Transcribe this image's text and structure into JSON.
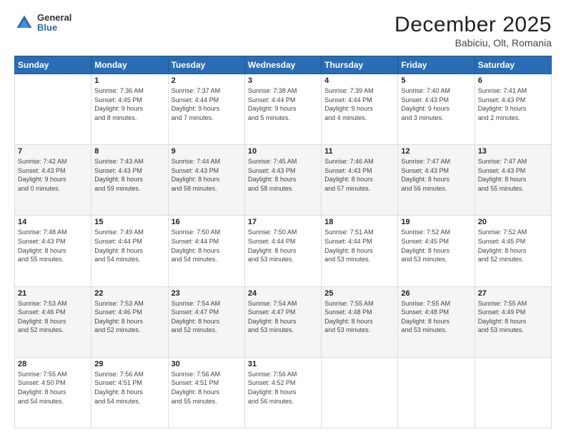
{
  "header": {
    "logo_general": "General",
    "logo_blue": "Blue",
    "title": "December 2025",
    "subtitle": "Babiciu, Olt, Romania"
  },
  "weekdays": [
    "Sunday",
    "Monday",
    "Tuesday",
    "Wednesday",
    "Thursday",
    "Friday",
    "Saturday"
  ],
  "weeks": [
    [
      {
        "day": "",
        "info": ""
      },
      {
        "day": "1",
        "info": "Sunrise: 7:36 AM\nSunset: 4:45 PM\nDaylight: 9 hours\nand 8 minutes."
      },
      {
        "day": "2",
        "info": "Sunrise: 7:37 AM\nSunset: 4:44 PM\nDaylight: 9 hours\nand 7 minutes."
      },
      {
        "day": "3",
        "info": "Sunrise: 7:38 AM\nSunset: 4:44 PM\nDaylight: 9 hours\nand 5 minutes."
      },
      {
        "day": "4",
        "info": "Sunrise: 7:39 AM\nSunset: 4:44 PM\nDaylight: 9 hours\nand 4 minutes."
      },
      {
        "day": "5",
        "info": "Sunrise: 7:40 AM\nSunset: 4:43 PM\nDaylight: 9 hours\nand 3 minutes."
      },
      {
        "day": "6",
        "info": "Sunrise: 7:41 AM\nSunset: 4:43 PM\nDaylight: 9 hours\nand 2 minutes."
      }
    ],
    [
      {
        "day": "7",
        "info": "Sunrise: 7:42 AM\nSunset: 4:43 PM\nDaylight: 9 hours\nand 0 minutes."
      },
      {
        "day": "8",
        "info": "Sunrise: 7:43 AM\nSunset: 4:43 PM\nDaylight: 8 hours\nand 59 minutes."
      },
      {
        "day": "9",
        "info": "Sunrise: 7:44 AM\nSunset: 4:43 PM\nDaylight: 8 hours\nand 58 minutes."
      },
      {
        "day": "10",
        "info": "Sunrise: 7:45 AM\nSunset: 4:43 PM\nDaylight: 8 hours\nand 58 minutes."
      },
      {
        "day": "11",
        "info": "Sunrise: 7:46 AM\nSunset: 4:43 PM\nDaylight: 8 hours\nand 57 minutes."
      },
      {
        "day": "12",
        "info": "Sunrise: 7:47 AM\nSunset: 4:43 PM\nDaylight: 8 hours\nand 56 minutes."
      },
      {
        "day": "13",
        "info": "Sunrise: 7:47 AM\nSunset: 4:43 PM\nDaylight: 8 hours\nand 55 minutes."
      }
    ],
    [
      {
        "day": "14",
        "info": "Sunrise: 7:48 AM\nSunset: 4:43 PM\nDaylight: 8 hours\nand 55 minutes."
      },
      {
        "day": "15",
        "info": "Sunrise: 7:49 AM\nSunset: 4:44 PM\nDaylight: 8 hours\nand 54 minutes."
      },
      {
        "day": "16",
        "info": "Sunrise: 7:50 AM\nSunset: 4:44 PM\nDaylight: 8 hours\nand 54 minutes."
      },
      {
        "day": "17",
        "info": "Sunrise: 7:50 AM\nSunset: 4:44 PM\nDaylight: 8 hours\nand 53 minutes."
      },
      {
        "day": "18",
        "info": "Sunrise: 7:51 AM\nSunset: 4:44 PM\nDaylight: 8 hours\nand 53 minutes."
      },
      {
        "day": "19",
        "info": "Sunrise: 7:52 AM\nSunset: 4:45 PM\nDaylight: 8 hours\nand 53 minutes."
      },
      {
        "day": "20",
        "info": "Sunrise: 7:52 AM\nSunset: 4:45 PM\nDaylight: 8 hours\nand 52 minutes."
      }
    ],
    [
      {
        "day": "21",
        "info": "Sunrise: 7:53 AM\nSunset: 4:46 PM\nDaylight: 8 hours\nand 52 minutes."
      },
      {
        "day": "22",
        "info": "Sunrise: 7:53 AM\nSunset: 4:46 PM\nDaylight: 8 hours\nand 52 minutes."
      },
      {
        "day": "23",
        "info": "Sunrise: 7:54 AM\nSunset: 4:47 PM\nDaylight: 8 hours\nand 52 minutes."
      },
      {
        "day": "24",
        "info": "Sunrise: 7:54 AM\nSunset: 4:47 PM\nDaylight: 8 hours\nand 53 minutes."
      },
      {
        "day": "25",
        "info": "Sunrise: 7:55 AM\nSunset: 4:48 PM\nDaylight: 8 hours\nand 53 minutes."
      },
      {
        "day": "26",
        "info": "Sunrise: 7:55 AM\nSunset: 4:48 PM\nDaylight: 8 hours\nand 53 minutes."
      },
      {
        "day": "27",
        "info": "Sunrise: 7:55 AM\nSunset: 4:49 PM\nDaylight: 8 hours\nand 53 minutes."
      }
    ],
    [
      {
        "day": "28",
        "info": "Sunrise: 7:55 AM\nSunset: 4:50 PM\nDaylight: 8 hours\nand 54 minutes."
      },
      {
        "day": "29",
        "info": "Sunrise: 7:56 AM\nSunset: 4:51 PM\nDaylight: 8 hours\nand 54 minutes."
      },
      {
        "day": "30",
        "info": "Sunrise: 7:56 AM\nSunset: 4:51 PM\nDaylight: 8 hours\nand 55 minutes."
      },
      {
        "day": "31",
        "info": "Sunrise: 7:56 AM\nSunset: 4:52 PM\nDaylight: 8 hours\nand 56 minutes."
      },
      {
        "day": "",
        "info": ""
      },
      {
        "day": "",
        "info": ""
      },
      {
        "day": "",
        "info": ""
      }
    ]
  ]
}
